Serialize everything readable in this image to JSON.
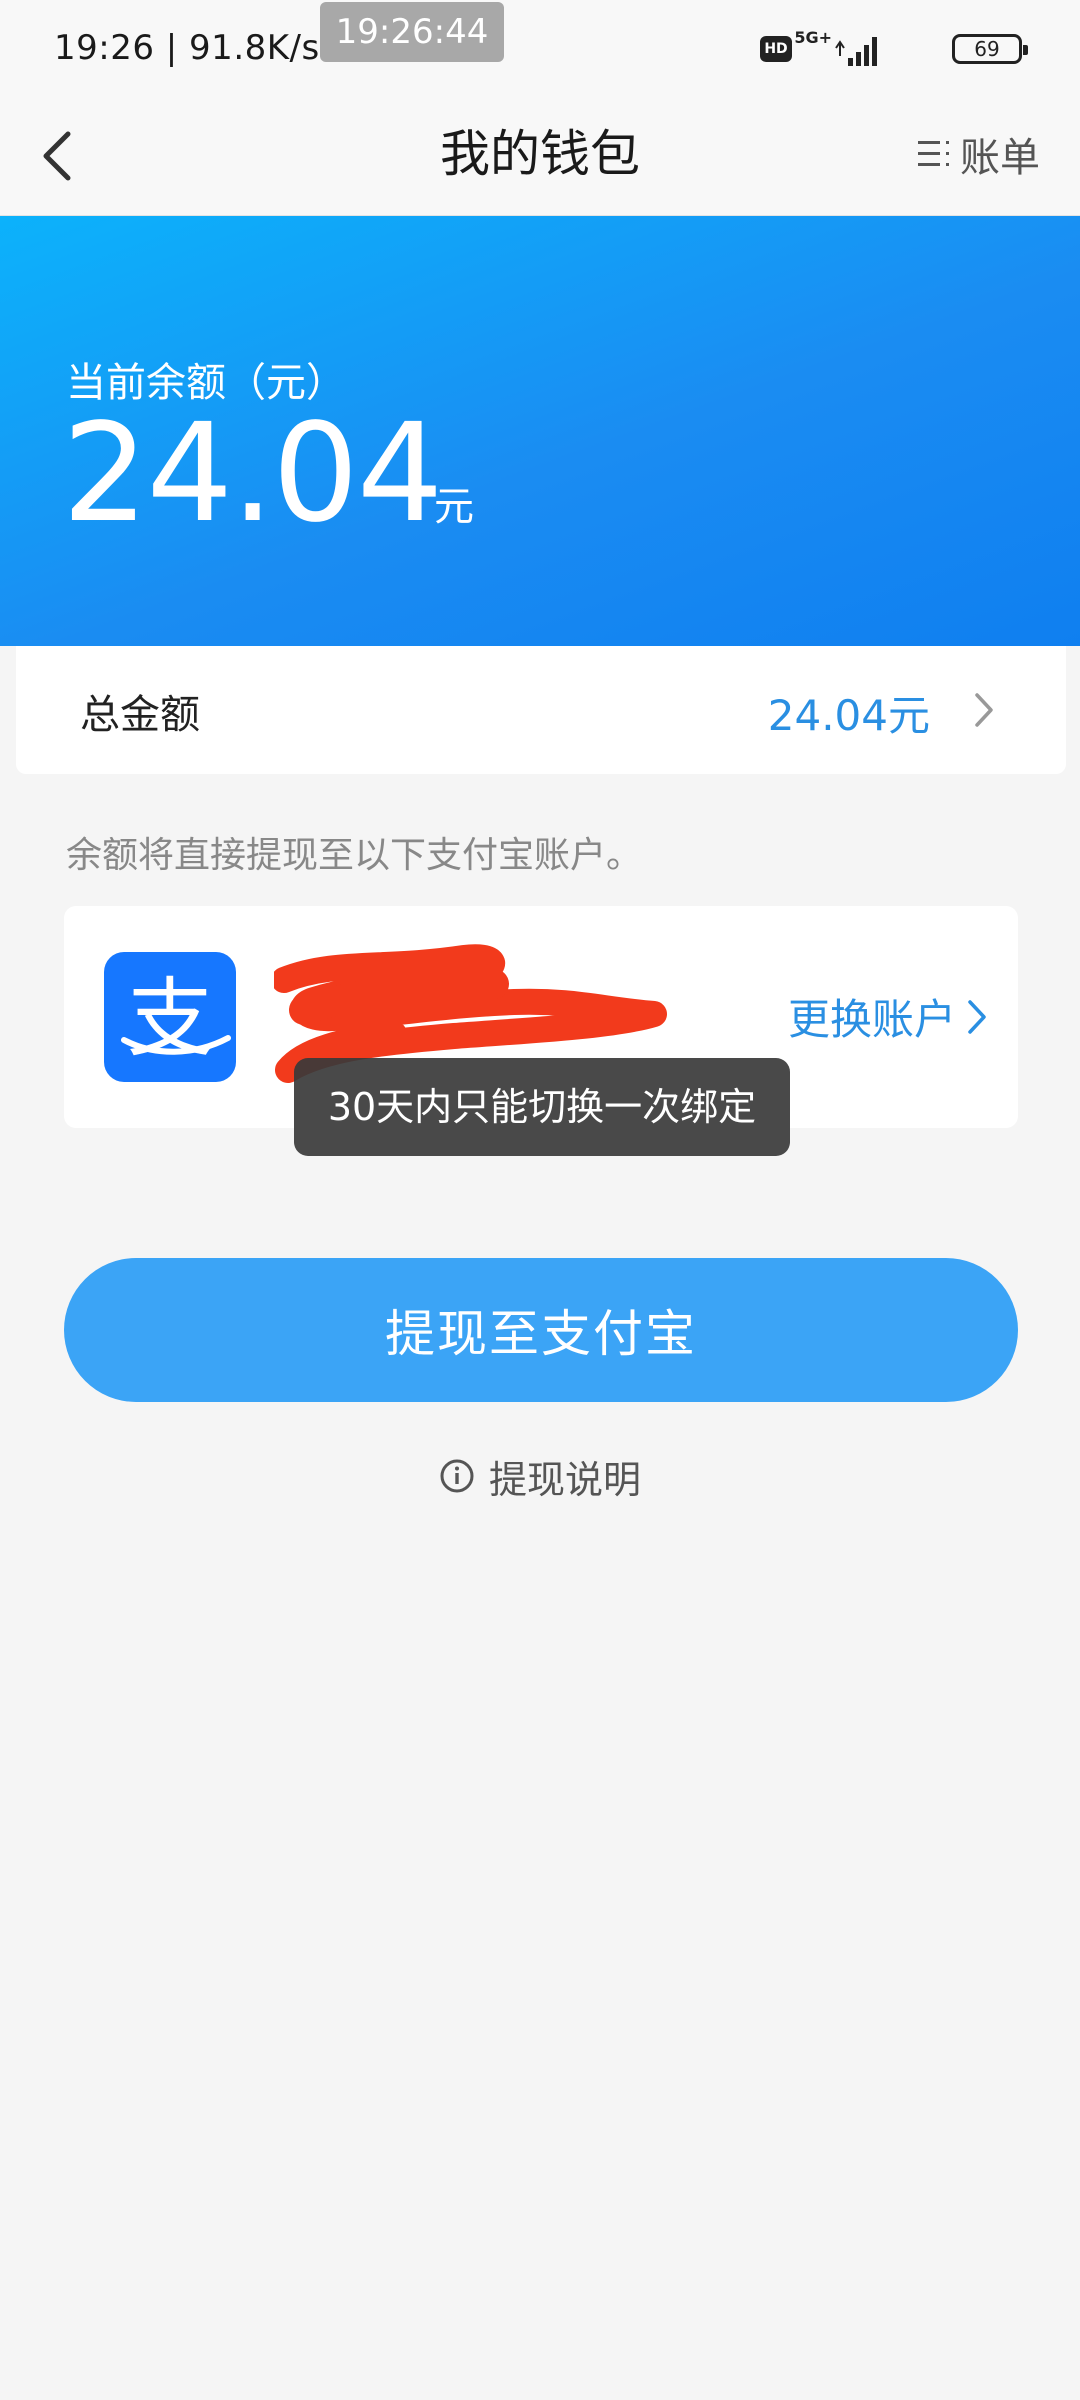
{
  "status_bar": {
    "left_text": "19:26 | 91.8K/s",
    "overlay_time": "19:26:44",
    "hd_label": "HD",
    "network_label": "5G+",
    "battery_level": "69"
  },
  "nav": {
    "title": "我的钱包",
    "bill_label": "账单"
  },
  "balance": {
    "label": "当前余额（元）",
    "amount": "24.04",
    "unit": "元"
  },
  "total": {
    "label": "总金额",
    "value": "24.04元"
  },
  "withdraw_hint": "余额将直接提现至以下支付宝账户。",
  "account": {
    "logo_char": "支",
    "change_label": "更换账户"
  },
  "toast": "30天内只能切换一次绑定",
  "withdraw_button": "提现至支付宝",
  "withdraw_info": "提现说明",
  "colors": {
    "banner": "#1a8cf2",
    "accent": "#2a8fe2",
    "button": "#3ba4f6",
    "alipay": "#1677ff",
    "redaction": "#f23a1c"
  }
}
